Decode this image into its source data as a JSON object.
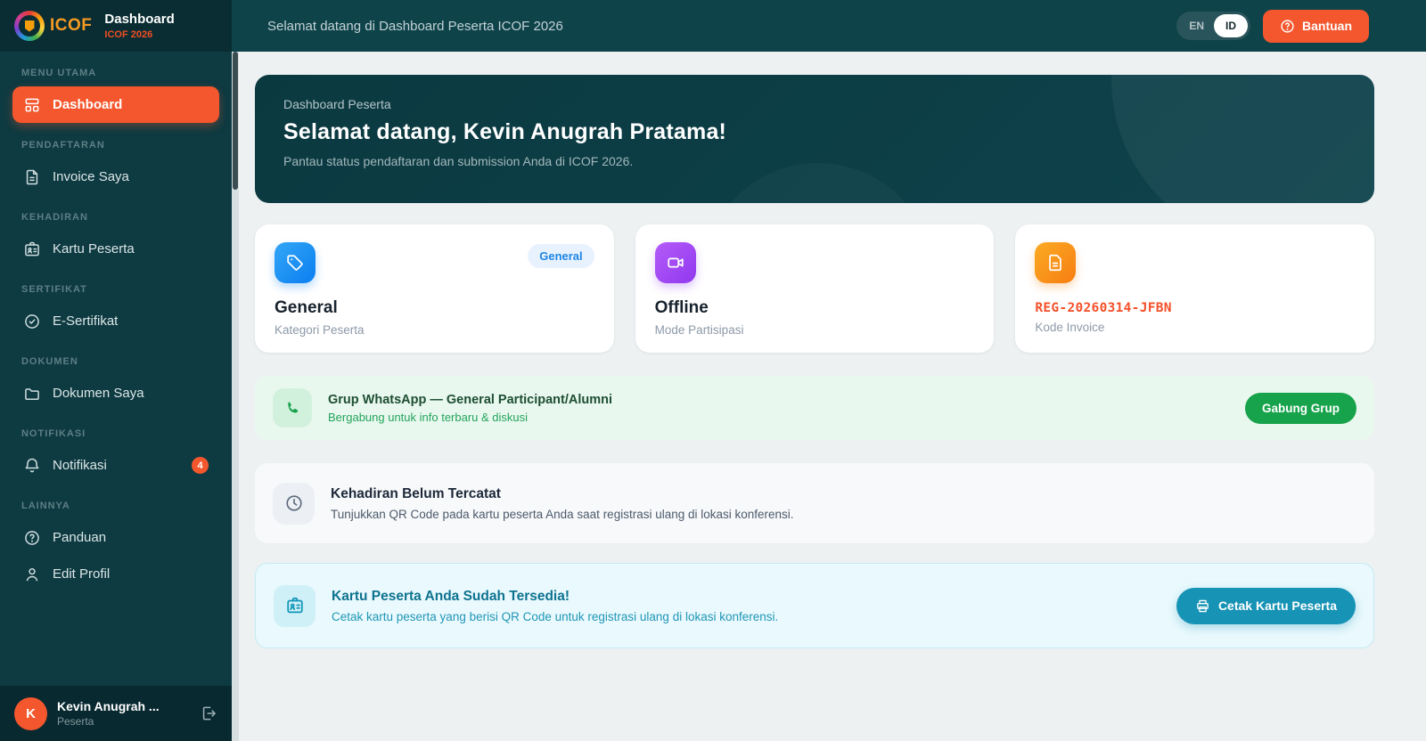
{
  "brand": {
    "logo_text": "ICOF",
    "page_title": "Dashboard",
    "event": "ICOF 2026"
  },
  "topbar": {
    "welcome": "Selamat datang di Dashboard Peserta ICOF 2026",
    "lang_en": "EN",
    "lang_id": "ID",
    "help_label": "Bantuan"
  },
  "sidebar": {
    "sections": [
      {
        "label": "MENU UTAMA",
        "items": [
          {
            "label": "Dashboard"
          }
        ]
      },
      {
        "label": "PENDAFTARAN",
        "items": [
          {
            "label": "Invoice Saya"
          }
        ]
      },
      {
        "label": "KEHADIRAN",
        "items": [
          {
            "label": "Kartu Peserta"
          }
        ]
      },
      {
        "label": "SERTIFIKAT",
        "items": [
          {
            "label": "E-Sertifikat"
          }
        ]
      },
      {
        "label": "DOKUMEN",
        "items": [
          {
            "label": "Dokumen Saya"
          }
        ]
      },
      {
        "label": "NOTIFIKASI",
        "items": [
          {
            "label": "Notifikasi",
            "badge": "4"
          }
        ]
      },
      {
        "label": "LAINNYA",
        "items": [
          {
            "label": "Panduan"
          },
          {
            "label": "Edit Profil"
          }
        ]
      }
    ],
    "user": {
      "name": "Kevin Anugrah ...",
      "role": "Peserta",
      "avatar_initial": "K"
    }
  },
  "banner": {
    "eyebrow": "Dashboard Peserta",
    "title": "Selamat datang, Kevin Anugrah Pratama!",
    "subtitle": "Pantau status pendaftaran dan submission Anda di ICOF 2026."
  },
  "stats": [
    {
      "title": "General",
      "subtitle": "Kategori Peserta",
      "badge": "General"
    },
    {
      "title": "Offline",
      "subtitle": "Mode Partisipasi"
    },
    {
      "title": "REG-20260314-JFBN",
      "subtitle": "Kode Invoice"
    }
  ],
  "whatsapp": {
    "title": "Grup WhatsApp — General Participant/Alumni",
    "subtitle": "Bergabung untuk info terbaru & diskusi",
    "button": "Gabung Grup"
  },
  "attendance": {
    "title": "Kehadiran Belum Tercatat",
    "subtitle": "Tunjukkan QR Code pada kartu peserta Anda saat registrasi ulang di lokasi konferensi."
  },
  "card_ready": {
    "title": "Kartu Peserta Anda Sudah Tersedia!",
    "subtitle": "Cetak kartu peserta yang berisi QR Code untuk registrasi ulang di lokasi konferensi.",
    "button": "Cetak Kartu Peserta"
  },
  "colors": {
    "accent_orange": "#f4572d",
    "sidebar_bg": "#0e3a41",
    "topbar_bg": "#0e434a",
    "green": "#17a34b",
    "cyan": "#1793b5",
    "blue_badge_text": "#1e86e5",
    "invoice_code_color": "#f4502a"
  }
}
